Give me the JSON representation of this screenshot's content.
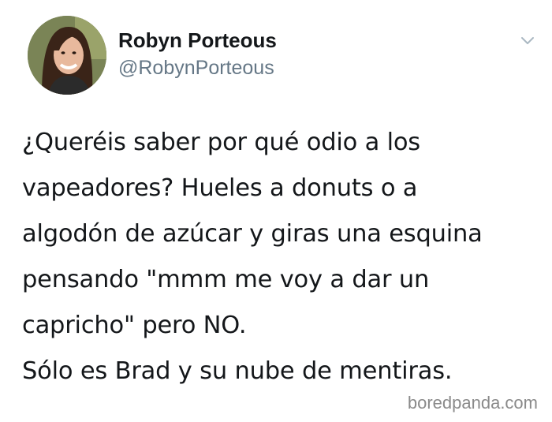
{
  "author": {
    "display_name": "Robyn Porteous",
    "handle": "@RobynPorteous"
  },
  "icons": {
    "avatar": "profile-photo",
    "menu": "chevron-down-icon"
  },
  "tweet": {
    "lines": [
      "¿Queréis saber por qué odio a los",
      "vapeadores? Hueles a donuts o a",
      "algodón de azúcar y giras una esquina",
      "pensando \"mmm me voy a dar un",
      "capricho\" pero NO.",
      "Sólo es Brad y su nube de mentiras."
    ]
  },
  "watermark": "boredpanda.com"
}
